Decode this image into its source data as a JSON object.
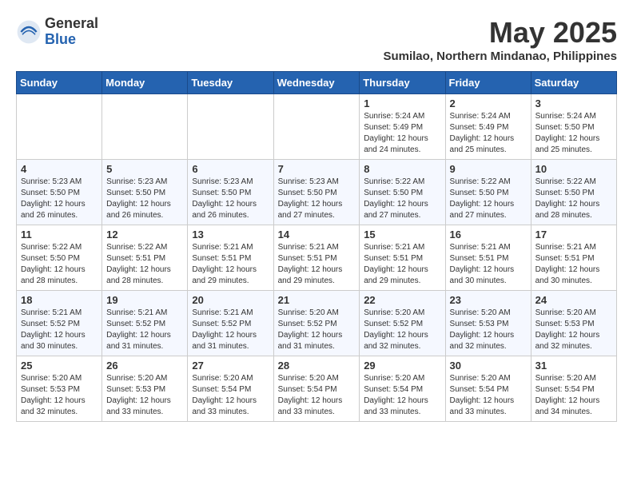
{
  "logo": {
    "general": "General",
    "blue": "Blue"
  },
  "title": "May 2025",
  "subtitle": "Sumilao, Northern Mindanao, Philippines",
  "headers": [
    "Sunday",
    "Monday",
    "Tuesday",
    "Wednesday",
    "Thursday",
    "Friday",
    "Saturday"
  ],
  "weeks": [
    [
      {
        "num": "",
        "info": ""
      },
      {
        "num": "",
        "info": ""
      },
      {
        "num": "",
        "info": ""
      },
      {
        "num": "",
        "info": ""
      },
      {
        "num": "1",
        "info": "Sunrise: 5:24 AM\nSunset: 5:49 PM\nDaylight: 12 hours\nand 24 minutes."
      },
      {
        "num": "2",
        "info": "Sunrise: 5:24 AM\nSunset: 5:49 PM\nDaylight: 12 hours\nand 25 minutes."
      },
      {
        "num": "3",
        "info": "Sunrise: 5:24 AM\nSunset: 5:50 PM\nDaylight: 12 hours\nand 25 minutes."
      }
    ],
    [
      {
        "num": "4",
        "info": "Sunrise: 5:23 AM\nSunset: 5:50 PM\nDaylight: 12 hours\nand 26 minutes."
      },
      {
        "num": "5",
        "info": "Sunrise: 5:23 AM\nSunset: 5:50 PM\nDaylight: 12 hours\nand 26 minutes."
      },
      {
        "num": "6",
        "info": "Sunrise: 5:23 AM\nSunset: 5:50 PM\nDaylight: 12 hours\nand 26 minutes."
      },
      {
        "num": "7",
        "info": "Sunrise: 5:23 AM\nSunset: 5:50 PM\nDaylight: 12 hours\nand 27 minutes."
      },
      {
        "num": "8",
        "info": "Sunrise: 5:22 AM\nSunset: 5:50 PM\nDaylight: 12 hours\nand 27 minutes."
      },
      {
        "num": "9",
        "info": "Sunrise: 5:22 AM\nSunset: 5:50 PM\nDaylight: 12 hours\nand 27 minutes."
      },
      {
        "num": "10",
        "info": "Sunrise: 5:22 AM\nSunset: 5:50 PM\nDaylight: 12 hours\nand 28 minutes."
      }
    ],
    [
      {
        "num": "11",
        "info": "Sunrise: 5:22 AM\nSunset: 5:50 PM\nDaylight: 12 hours\nand 28 minutes."
      },
      {
        "num": "12",
        "info": "Sunrise: 5:22 AM\nSunset: 5:51 PM\nDaylight: 12 hours\nand 28 minutes."
      },
      {
        "num": "13",
        "info": "Sunrise: 5:21 AM\nSunset: 5:51 PM\nDaylight: 12 hours\nand 29 minutes."
      },
      {
        "num": "14",
        "info": "Sunrise: 5:21 AM\nSunset: 5:51 PM\nDaylight: 12 hours\nand 29 minutes."
      },
      {
        "num": "15",
        "info": "Sunrise: 5:21 AM\nSunset: 5:51 PM\nDaylight: 12 hours\nand 29 minutes."
      },
      {
        "num": "16",
        "info": "Sunrise: 5:21 AM\nSunset: 5:51 PM\nDaylight: 12 hours\nand 30 minutes."
      },
      {
        "num": "17",
        "info": "Sunrise: 5:21 AM\nSunset: 5:51 PM\nDaylight: 12 hours\nand 30 minutes."
      }
    ],
    [
      {
        "num": "18",
        "info": "Sunrise: 5:21 AM\nSunset: 5:52 PM\nDaylight: 12 hours\nand 30 minutes."
      },
      {
        "num": "19",
        "info": "Sunrise: 5:21 AM\nSunset: 5:52 PM\nDaylight: 12 hours\nand 31 minutes."
      },
      {
        "num": "20",
        "info": "Sunrise: 5:21 AM\nSunset: 5:52 PM\nDaylight: 12 hours\nand 31 minutes."
      },
      {
        "num": "21",
        "info": "Sunrise: 5:20 AM\nSunset: 5:52 PM\nDaylight: 12 hours\nand 31 minutes."
      },
      {
        "num": "22",
        "info": "Sunrise: 5:20 AM\nSunset: 5:52 PM\nDaylight: 12 hours\nand 32 minutes."
      },
      {
        "num": "23",
        "info": "Sunrise: 5:20 AM\nSunset: 5:53 PM\nDaylight: 12 hours\nand 32 minutes."
      },
      {
        "num": "24",
        "info": "Sunrise: 5:20 AM\nSunset: 5:53 PM\nDaylight: 12 hours\nand 32 minutes."
      }
    ],
    [
      {
        "num": "25",
        "info": "Sunrise: 5:20 AM\nSunset: 5:53 PM\nDaylight: 12 hours\nand 32 minutes."
      },
      {
        "num": "26",
        "info": "Sunrise: 5:20 AM\nSunset: 5:53 PM\nDaylight: 12 hours\nand 33 minutes."
      },
      {
        "num": "27",
        "info": "Sunrise: 5:20 AM\nSunset: 5:54 PM\nDaylight: 12 hours\nand 33 minutes."
      },
      {
        "num": "28",
        "info": "Sunrise: 5:20 AM\nSunset: 5:54 PM\nDaylight: 12 hours\nand 33 minutes."
      },
      {
        "num": "29",
        "info": "Sunrise: 5:20 AM\nSunset: 5:54 PM\nDaylight: 12 hours\nand 33 minutes."
      },
      {
        "num": "30",
        "info": "Sunrise: 5:20 AM\nSunset: 5:54 PM\nDaylight: 12 hours\nand 33 minutes."
      },
      {
        "num": "31",
        "info": "Sunrise: 5:20 AM\nSunset: 5:54 PM\nDaylight: 12 hours\nand 34 minutes."
      }
    ]
  ]
}
